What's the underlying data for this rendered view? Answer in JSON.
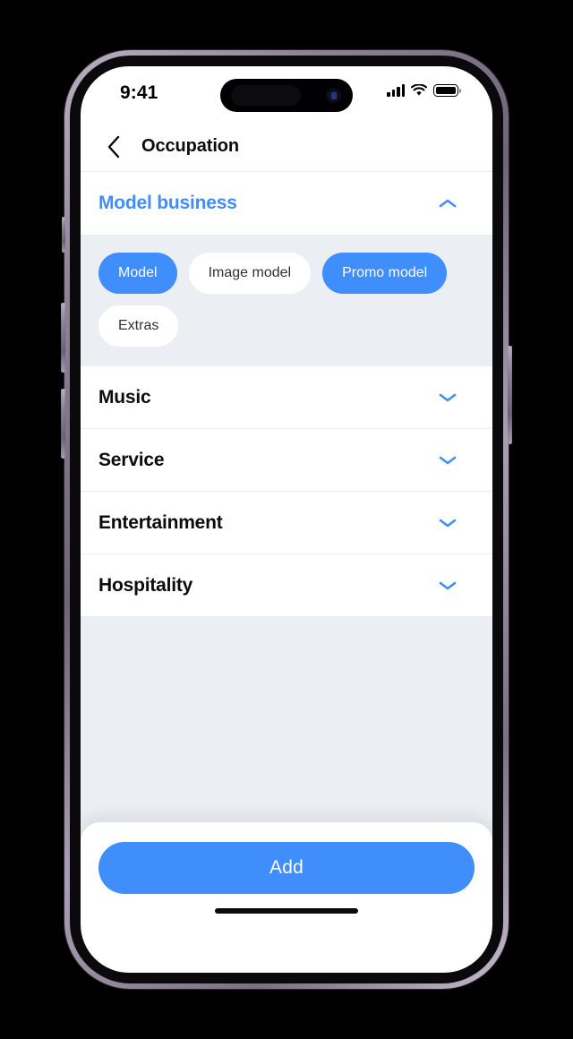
{
  "status_bar": {
    "time": "9:41",
    "icons": [
      "cellular-signal-icon",
      "wifi-icon",
      "battery-icon"
    ],
    "signal_bars": 4,
    "battery_level": 100
  },
  "header": {
    "back_icon": "chevron-left-icon",
    "title": "Occupation"
  },
  "theme": {
    "accent": "#3f8efc",
    "page_bg": "#ebeef2",
    "card_bg": "#ffffff",
    "text": "#0c0c0c",
    "chip_text": "#2f3338",
    "divider": "#eceff3"
  },
  "sections": [
    {
      "title": "Model business",
      "expanded": true,
      "chevron": "chevron-up-icon",
      "chips": [
        {
          "label": "Model",
          "selected": true
        },
        {
          "label": "Image model",
          "selected": false
        },
        {
          "label": "Promo model",
          "selected": true
        },
        {
          "label": "Extras",
          "selected": false
        }
      ]
    },
    {
      "title": "Music",
      "expanded": false,
      "chevron": "chevron-down-icon",
      "chips": []
    },
    {
      "title": "Service",
      "expanded": false,
      "chevron": "chevron-down-icon",
      "chips": []
    },
    {
      "title": "Entertainment",
      "expanded": false,
      "chevron": "chevron-down-icon",
      "chips": []
    },
    {
      "title": "Hospitality",
      "expanded": false,
      "chevron": "chevron-down-icon",
      "chips": []
    }
  ],
  "footer": {
    "add_label": "Add"
  }
}
